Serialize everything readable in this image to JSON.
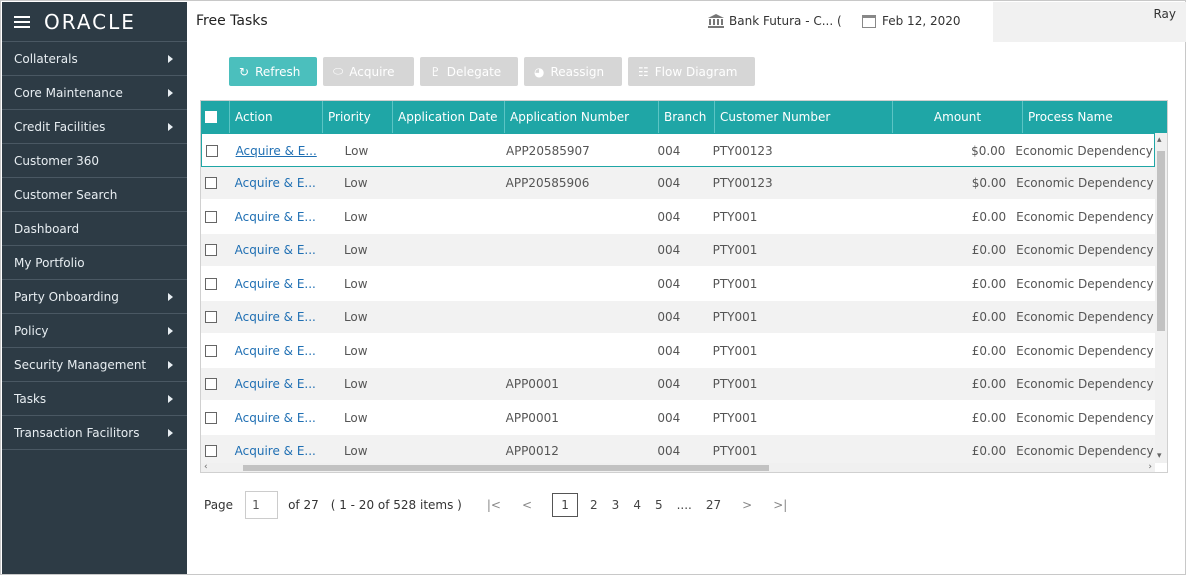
{
  "app": {
    "logo": "ORACLE"
  },
  "sidebar": {
    "items": [
      {
        "label": "Collaterals",
        "arrow": true
      },
      {
        "label": "Core Maintenance",
        "arrow": true
      },
      {
        "label": "Credit Facilities",
        "arrow": true
      },
      {
        "label": "Customer 360",
        "arrow": false
      },
      {
        "label": "Customer Search",
        "arrow": false
      },
      {
        "label": "Dashboard",
        "arrow": false
      },
      {
        "label": "My Portfolio",
        "arrow": false
      },
      {
        "label": "Party Onboarding",
        "arrow": true
      },
      {
        "label": "Policy",
        "arrow": true
      },
      {
        "label": "Security Management",
        "arrow": true
      },
      {
        "label": "Tasks",
        "arrow": true
      },
      {
        "label": "Transaction Facilitors",
        "arrow": true
      }
    ]
  },
  "header": {
    "title": "Free Tasks",
    "bank": "Bank Futura - C... (",
    "date": "Feb 12, 2020",
    "user": "Ray"
  },
  "toolbar": {
    "refresh": "Refresh",
    "acquire": "Acquire",
    "delegate": "Delegate",
    "reassign": "Reassign",
    "flow_diagram": "Flow Diagram"
  },
  "grid": {
    "columns": [
      "Action",
      "Priority",
      "Application Date",
      "Application Number",
      "Branch",
      "Customer Number",
      "Amount",
      "Process Name"
    ],
    "rows": [
      {
        "action": "Acquire & E...",
        "priority": "Low",
        "app_date": "",
        "app_number": "APP20585907",
        "branch": "004",
        "customer": "PTY00123",
        "amount": "$0.00",
        "process": "Economic Dependency"
      },
      {
        "action": "Acquire & E...",
        "priority": "Low",
        "app_date": "",
        "app_number": "APP20585906",
        "branch": "004",
        "customer": "PTY00123",
        "amount": "$0.00",
        "process": "Economic Dependency"
      },
      {
        "action": "Acquire & E...",
        "priority": "Low",
        "app_date": "",
        "app_number": "",
        "branch": "004",
        "customer": "PTY001",
        "amount": "£0.00",
        "process": "Economic Dependency"
      },
      {
        "action": "Acquire & E...",
        "priority": "Low",
        "app_date": "",
        "app_number": "",
        "branch": "004",
        "customer": "PTY001",
        "amount": "£0.00",
        "process": "Economic Dependency"
      },
      {
        "action": "Acquire & E...",
        "priority": "Low",
        "app_date": "",
        "app_number": "",
        "branch": "004",
        "customer": "PTY001",
        "amount": "£0.00",
        "process": "Economic Dependency"
      },
      {
        "action": "Acquire & E...",
        "priority": "Low",
        "app_date": "",
        "app_number": "",
        "branch": "004",
        "customer": "PTY001",
        "amount": "£0.00",
        "process": "Economic Dependency"
      },
      {
        "action": "Acquire & E...",
        "priority": "Low",
        "app_date": "",
        "app_number": "",
        "branch": "004",
        "customer": "PTY001",
        "amount": "£0.00",
        "process": "Economic Dependency"
      },
      {
        "action": "Acquire & E...",
        "priority": "Low",
        "app_date": "",
        "app_number": "APP0001",
        "branch": "004",
        "customer": "PTY001",
        "amount": "£0.00",
        "process": "Economic Dependency"
      },
      {
        "action": "Acquire & E...",
        "priority": "Low",
        "app_date": "",
        "app_number": "APP0001",
        "branch": "004",
        "customer": "PTY001",
        "amount": "£0.00",
        "process": "Economic Dependency"
      },
      {
        "action": "Acquire & E...",
        "priority": "Low",
        "app_date": "",
        "app_number": "APP0012",
        "branch": "004",
        "customer": "PTY001",
        "amount": "£0.00",
        "process": "Economic Dependency"
      }
    ]
  },
  "pager": {
    "label": "Page",
    "current": "1",
    "of_total": "of 27",
    "range": "( 1 - 20 of 528 items )",
    "pages": [
      "1",
      "2",
      "3",
      "4",
      "5",
      "....",
      "27"
    ],
    "first": "K",
    "prev": "<",
    "next": ">",
    "last": "K"
  }
}
